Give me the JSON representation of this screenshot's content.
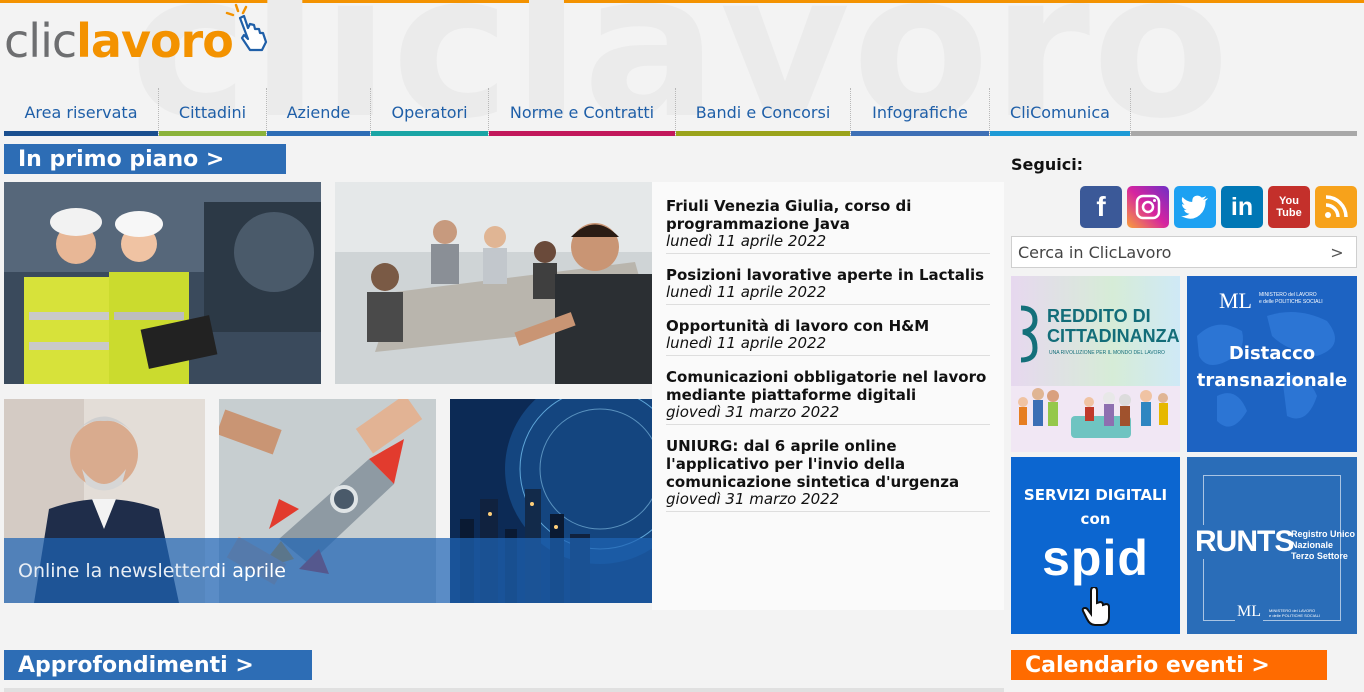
{
  "brand": {
    "clic": "clic",
    "lavoro": "lavoro"
  },
  "nav": [
    {
      "label": "Area riservata",
      "color": "#1a4f8f"
    },
    {
      "label": "Cittadini",
      "color": "#8bb33a"
    },
    {
      "label": "Aziende",
      "color": "#2d6db5"
    },
    {
      "label": "Operatori",
      "color": "#1aa5a5"
    },
    {
      "label": "Norme e Contratti",
      "color": "#c2185b"
    },
    {
      "label": "Bandi e Concorsi",
      "color": "#9aa31b"
    },
    {
      "label": "Infografiche",
      "color": "#3d6fb5"
    },
    {
      "label": "CliComunica",
      "color": "#1e9ad6"
    }
  ],
  "primo_piano": {
    "title": "In primo piano >"
  },
  "newsletter": {
    "part1": "Online la newsletter",
    "part2": " di aprile"
  },
  "news": [
    {
      "title": "Friuli Venezia Giulia, corso di programmazione Java",
      "date": "lunedì 11 aprile 2022"
    },
    {
      "title": "Posizioni lavorative aperte in Lactalis",
      "date": "lunedì 11 aprile 2022"
    },
    {
      "title": "Opportunità di lavoro con H&M",
      "date": "lunedì 11 aprile 2022"
    },
    {
      "title": "Comunicazioni obbligatorie nel lavoro mediante piattaforme digitali",
      "date": "giovedì 31 marzo 2022"
    },
    {
      "title": "UNIURG: dal 6 aprile online l'applicativo per l'invio della comunicazione sintetica d'urgenza",
      "date": "giovedì 31 marzo 2022"
    }
  ],
  "sidebar": {
    "follow": "Seguici:",
    "social": [
      {
        "name": "facebook",
        "glyph": "f",
        "color": "#3b5998"
      },
      {
        "name": "instagram",
        "glyph": "◎",
        "color": "#d6249f"
      },
      {
        "name": "twitter",
        "glyph": "🐦",
        "color": "#1da1f2"
      },
      {
        "name": "linkedin",
        "glyph": "in",
        "color": "#0077b5"
      },
      {
        "name": "youtube",
        "glyph": "You Tube",
        "color": "#c4302b"
      },
      {
        "name": "rss",
        "glyph": "rss",
        "color": "#f7a21b"
      }
    ],
    "search_placeholder": "Cerca in ClicLavoro",
    "search_go": ">"
  },
  "cards": {
    "reddito": {
      "line1": "REDDITO DI",
      "line2": "CITTADINANZA",
      "tagline": "UNA RIVOLUZIONE PER IL MONDO DEL LAVORO"
    },
    "distacco": {
      "line1": "Distacco",
      "line2": "transnazionale",
      "ministry_l1": "MINISTERO del LAVORO",
      "ministry_l2": "e delle POLITICHE SOCIALI"
    },
    "spid": {
      "line1": "SERVIZI DIGITALI",
      "line2": "con",
      "logo": "spid"
    },
    "runts": {
      "acronym": "RUNTS",
      "l1": "Registro Unico",
      "l2": "Nazionale",
      "l3": "Terzo Settore",
      "ministry_l1": "MINISTERO del LAVORO",
      "ministry_l2": "e delle POLITICHE SOCIALI"
    }
  },
  "approfondimenti": {
    "title": "Approfondimenti >"
  },
  "calendario": {
    "title": "Calendario eventi >"
  }
}
